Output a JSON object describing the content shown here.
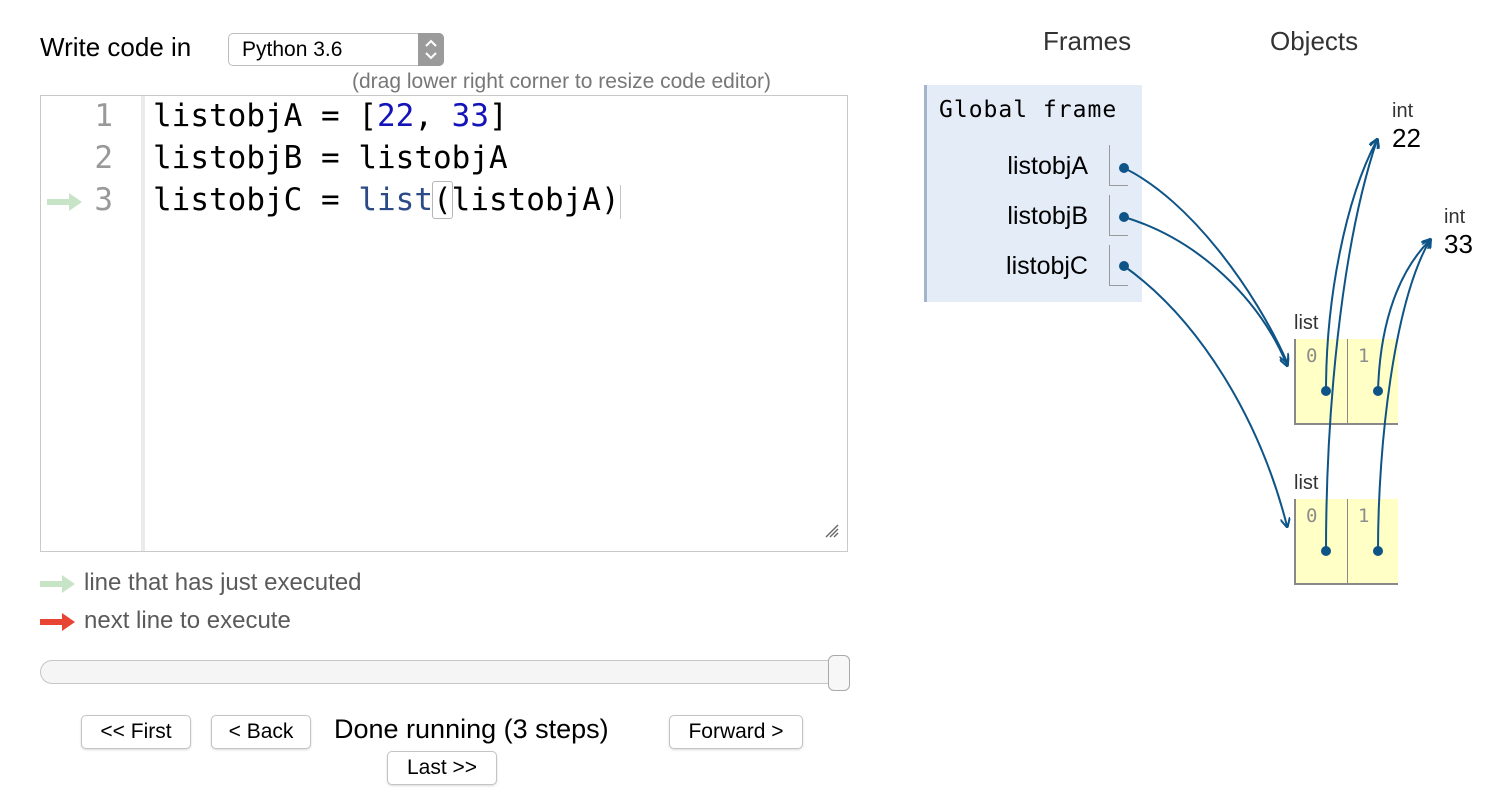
{
  "editor": {
    "write_label": "Write code in",
    "language": "Python 3.6",
    "resize_hint": "(drag lower right corner to resize code editor)",
    "lines": [
      {
        "number": "1",
        "name": "listobjA",
        "op": "=",
        "bracket_open": "[",
        "num1": "22",
        "comma": ",",
        "num2": "33",
        "bracket_close": "]"
      },
      {
        "number": "2",
        "name": "listobjB",
        "op": "=",
        "value": "listobjA"
      },
      {
        "number": "3",
        "name": "listobjC",
        "op": "=",
        "func": "list",
        "paren_open": "(",
        "arg": "listobjA",
        "paren_close": ")"
      }
    ]
  },
  "legend": {
    "executed": "line that has just executed",
    "next": "next line to execute",
    "executed_color": "#c7e5c6",
    "next_color": "#e84433"
  },
  "controls": {
    "slider_progress": 1.0,
    "first": "<< First",
    "back": "< Back",
    "status": "Done running (3 steps)",
    "forward": "Forward >",
    "last": "Last >>"
  },
  "viz": {
    "frames_heading": "Frames",
    "objects_heading": "Objects",
    "global_frame": "Global frame",
    "variables": [
      "listobjA",
      "listobjB",
      "listobjC"
    ],
    "ints": [
      {
        "type": "int",
        "value": "22"
      },
      {
        "type": "int",
        "value": "33"
      }
    ],
    "lists": [
      {
        "type": "list",
        "indices": [
          "0",
          "1"
        ]
      },
      {
        "type": "list",
        "indices": [
          "0",
          "1"
        ]
      }
    ],
    "arrow_color": "#0f5486"
  }
}
